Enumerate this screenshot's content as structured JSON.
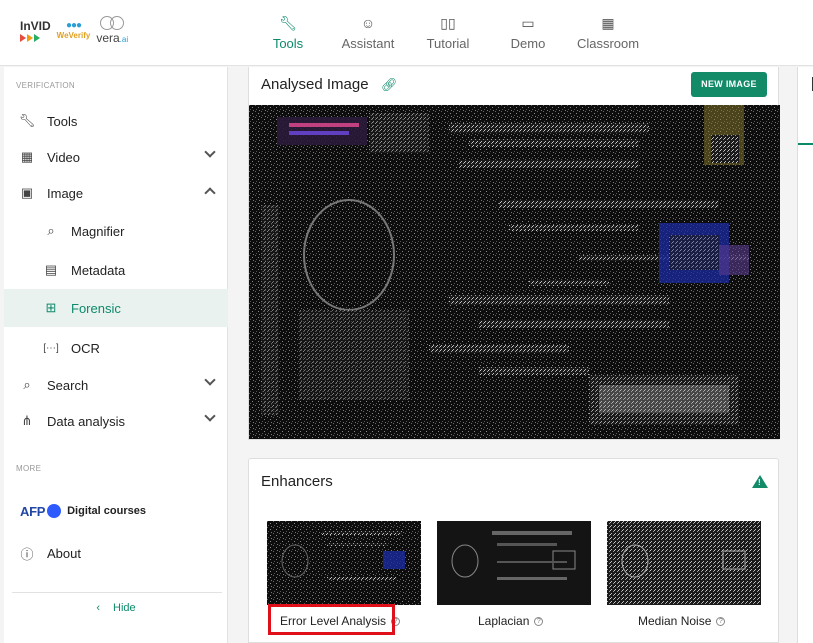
{
  "brand": {
    "invid": "InVID",
    "weverify": "WeVerify",
    "vera": "vera",
    "vera_suffix": ".ai"
  },
  "nav": [
    {
      "label": "Tools",
      "icon": "wrench-icon",
      "active": true
    },
    {
      "label": "Assistant",
      "icon": "robot-icon",
      "active": false
    },
    {
      "label": "Tutorial",
      "icon": "book-icon",
      "active": false
    },
    {
      "label": "Demo",
      "icon": "gamepad-icon",
      "active": false
    },
    {
      "label": "Classroom",
      "icon": "classroom-icon",
      "active": false
    }
  ],
  "sidebar": {
    "section_verification": "VERIFICATION",
    "items": [
      {
        "label": "Tools",
        "icon": "wrench-icon"
      },
      {
        "label": "Video",
        "icon": "film-icon"
      },
      {
        "label": "Image",
        "icon": "image-icon"
      },
      {
        "label": "Magnifier",
        "icon": "magnifier-icon"
      },
      {
        "label": "Metadata",
        "icon": "document-icon"
      },
      {
        "label": "Forensic",
        "icon": "forensic-icon"
      },
      {
        "label": "OCR",
        "icon": "ocr-icon"
      },
      {
        "label": "Search",
        "icon": "search-icon"
      },
      {
        "label": "Data analysis",
        "icon": "graph-icon"
      }
    ],
    "section_more": "MORE",
    "afp": "AFP",
    "digital_courses": "Digital courses",
    "about": "About",
    "hide": "Hide"
  },
  "main": {
    "title": "Analysed Image",
    "new_image": "NEW IMAGE"
  },
  "enhancers": {
    "title": "Enhancers",
    "filters": [
      {
        "label": "Error Level Analysis"
      },
      {
        "label": "Laplacian"
      },
      {
        "label": "Median Noise"
      }
    ]
  },
  "colors": {
    "accent": "#138a68",
    "highlight": "#e0101b"
  }
}
